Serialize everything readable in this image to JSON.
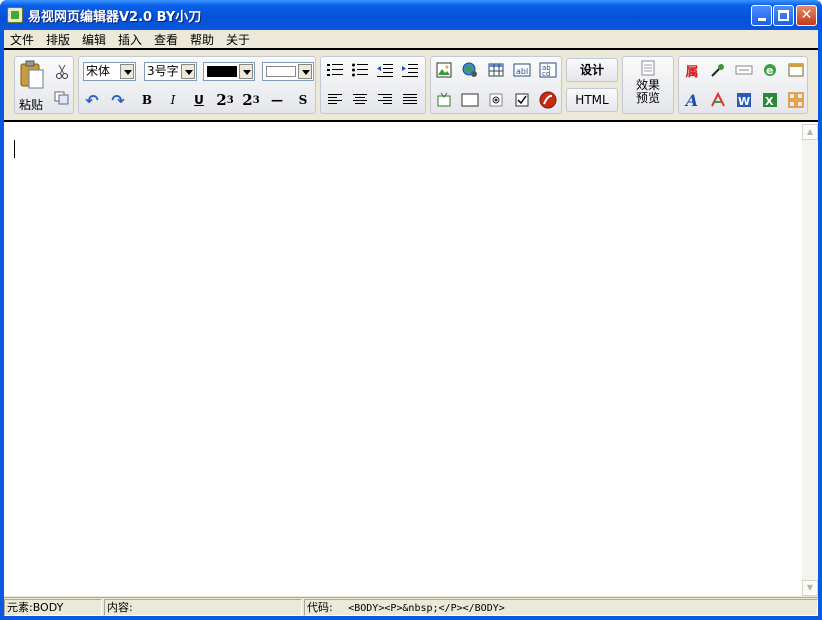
{
  "window": {
    "title": "易视网页编辑器V2.0 BY小刀",
    "controls": [
      "minimize",
      "maximize",
      "close"
    ]
  },
  "menu": [
    "文件",
    "排版",
    "编辑",
    "插入",
    "查看",
    "帮助",
    "关于"
  ],
  "toolbar": {
    "paste_label": "粘贴",
    "font_name": "宋体",
    "font_size": "3号字",
    "fore_color": "#000000",
    "back_color": "#ffffff",
    "bold": "B",
    "italic": "I",
    "underline": "U",
    "superscript_base": "2",
    "superscript_exp": "3",
    "subscript_base": "2",
    "subscript_sub": "3",
    "hr_symbol": "—",
    "strike": "S",
    "design_label": "设计",
    "html_label": "HTML",
    "preview_label_1": "效果",
    "preview_label_2": "预览"
  },
  "statusbar": {
    "element": "元素:BODY",
    "content": "内容:",
    "code_label": "代码:",
    "code_value": "<BODY><P>&nbsp;</P></BODY>"
  }
}
